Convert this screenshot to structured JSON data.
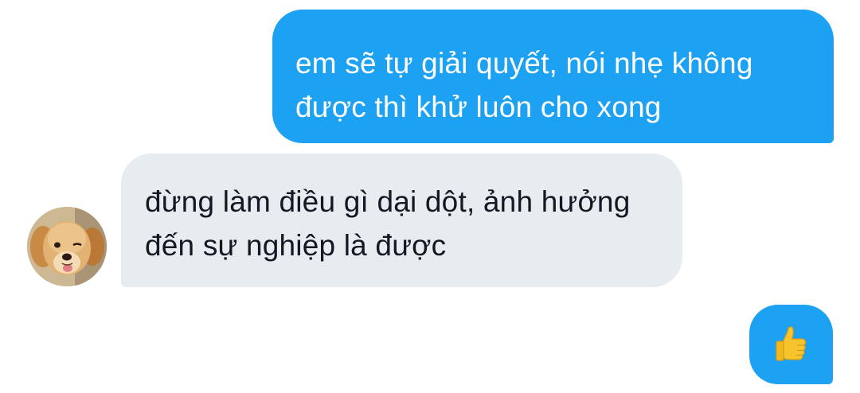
{
  "conversation": {
    "messages": [
      {
        "direction": "outgoing",
        "lines": [
          "em sẽ tự giải quyết, nói nhẹ không",
          "được thì khử luôn cho xong"
        ]
      },
      {
        "direction": "incoming",
        "lines": [
          "đừng làm điều gì dại dột, ảnh hưởng",
          "đến sự nghiệp là được"
        ]
      },
      {
        "direction": "outgoing",
        "icon": "thumbs-up-icon"
      }
    ],
    "contact_avatar_icon": "golden-retriever-puppy-avatar"
  },
  "colors": {
    "outgoing_bubble": "#1da1f2",
    "incoming_bubble": "#e7ecf1",
    "outgoing_text": "#ffffff",
    "incoming_text": "#141823",
    "thumbs_up": "#f7c42d"
  }
}
